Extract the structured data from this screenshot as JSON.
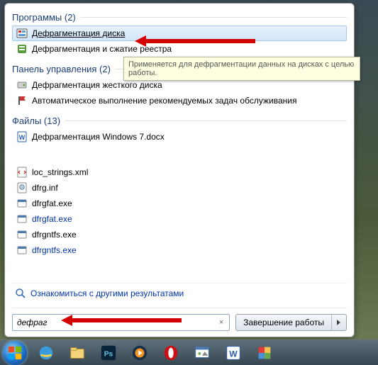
{
  "sections": {
    "programs": {
      "title": "Программы",
      "count": 2
    },
    "controlPanel": {
      "title": "Панель управления",
      "count": 2
    },
    "files": {
      "title": "Файлы",
      "count": 13
    }
  },
  "results": {
    "programs": [
      {
        "label": "Дефрагментация диска",
        "iconColor": "#c33"
      },
      {
        "label": "Дефрагментация и сжатие реестра",
        "iconColor": "#559a3c"
      }
    ],
    "controlPanel": [
      {
        "label": "Дефрагментация жесткого диска",
        "iconColor": "#8a8a8a"
      },
      {
        "label": "Автоматическое выполнение рекомендуемых задач обслуживания",
        "iconColor": "#c33"
      }
    ],
    "files": [
      {
        "label": "Дефрагментация Windows 7.docx",
        "iconColor": "#2a5db0",
        "type": "docx"
      },
      {
        "label": "loc_strings.xml",
        "type": "xml"
      },
      {
        "label": "dfrg.inf",
        "type": "inf"
      },
      {
        "label": "dfrgfat.exe",
        "type": "exe"
      },
      {
        "label": "dfrgfat.exe",
        "type": "exe",
        "link": true
      },
      {
        "label": "dfrgntfs.exe",
        "type": "exe"
      },
      {
        "label": "dfrgntfs.exe",
        "type": "exe",
        "link": true
      }
    ]
  },
  "tooltip": "Применяется для дефрагментации данных на дисках с целью работы.",
  "seeMore": "Ознакомиться с другими результатами",
  "search": {
    "value": "дефраг",
    "placeholder": ""
  },
  "shutdown": "Завершение работы"
}
